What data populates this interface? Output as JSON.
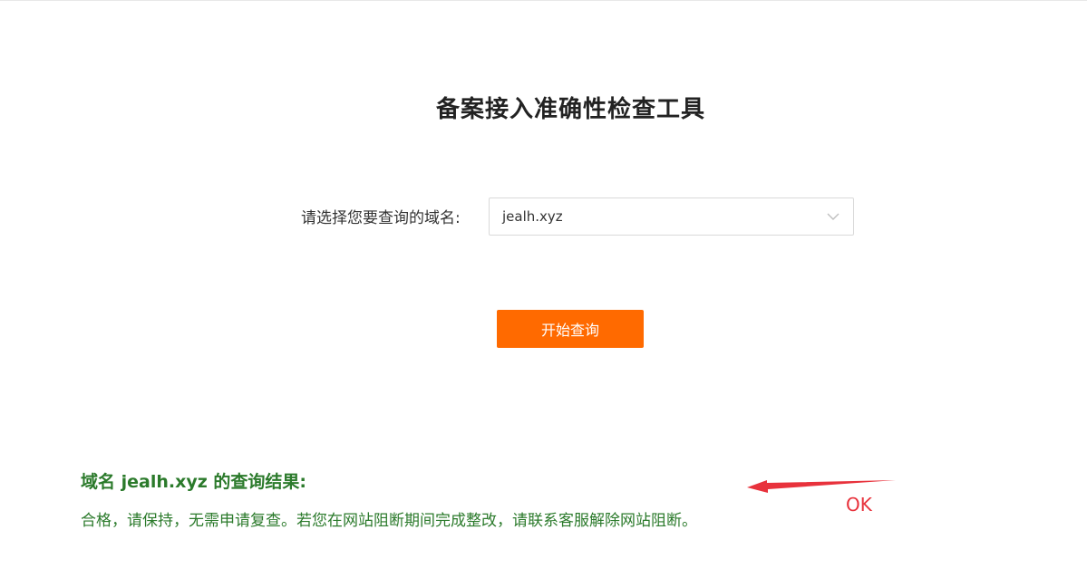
{
  "page": {
    "title": "备案接入准确性检查工具"
  },
  "domain_select": {
    "label": "请选择您要查询的域名:",
    "value": "jealh.xyz"
  },
  "actions": {
    "start_query_label": "开始查询"
  },
  "result": {
    "title": "域名 jealh.xyz 的查询结果:",
    "text": "合格，请保持，无需申请复查。若您在网站阻断期间完成整改，请联系客服解除网站阻断。"
  },
  "annotation": {
    "note": "OK",
    "color": "#e8323c"
  },
  "colors": {
    "accent": "#ff6a00",
    "success": "#2b7a2b"
  }
}
